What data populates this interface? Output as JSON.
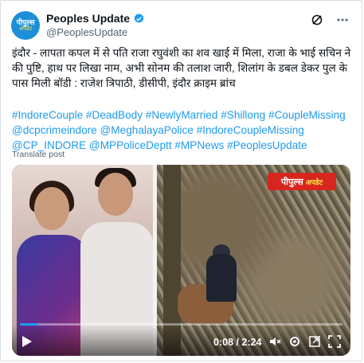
{
  "account": {
    "avatar_line1": "पीपुल्स",
    "avatar_line2": "अपडेट",
    "name": "Peoples Update",
    "handle": "@PeoplesUpdate"
  },
  "post": {
    "text": "इंदौर - लापता कपल में से पति राजा रघुवंशी का शव खाई में मिला, राजा के भाई सचिन ने की पुष्टि, हाथ पर लिखा नाम, अभी सोनम की तलाश जारी, शिलांग के डबल डेकर पुल के पास मिली बॉडी : राजेश त्रिपाठी, डीसीपी, इंदौर क्राइम ब्रांच",
    "hashtags": "#IndoreCouple #DeadBody #NewlyMarried #Shillong #CoupleMissing @dcpcrimeindore @MeghalayaPolice #IndoreCoupleMissing @CP_INDORE @MPPoliceDeptt #MPNews #PeoplesUpdate",
    "translate": "Translate post"
  },
  "video": {
    "brand_main": "पीपुल्स",
    "brand_sub": "अपडेट",
    "time": "0:08 / 2:24",
    "progress": 0.056
  },
  "colors": {
    "link": "#1d9bf0",
    "text": "#0f1419",
    "muted": "#536471",
    "brand_red": "#d8261e"
  },
  "icons": [
    "verified-badge-icon",
    "grok-icon",
    "more-icon",
    "play-icon",
    "volume-icon",
    "settings-icon",
    "fullscreen-expand-icon",
    "fullscreen-icon"
  ]
}
